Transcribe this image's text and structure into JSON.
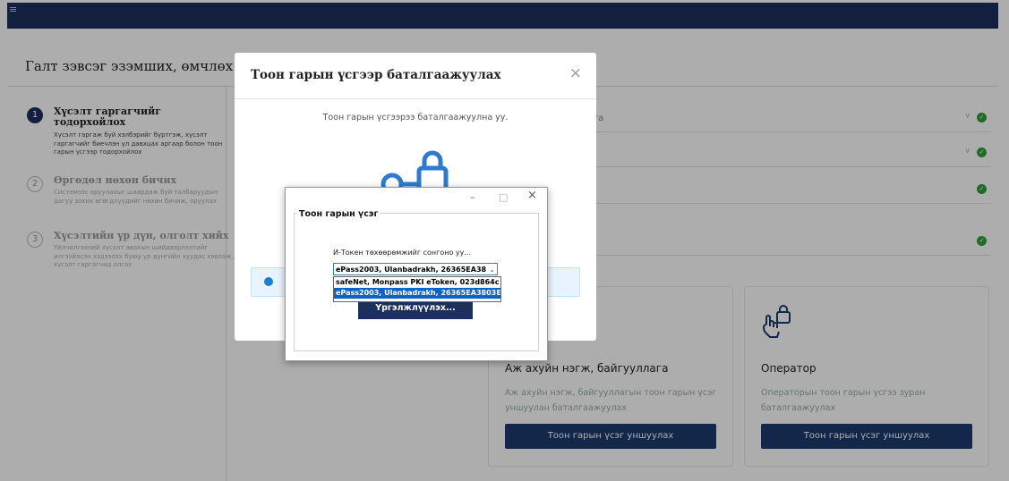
{
  "page": {
    "title": "Галт зэвсэг эзэмших, өмчлөх эрх"
  },
  "steps": [
    {
      "number": "1",
      "title": "Хүсэлт гаргагчийг тодорхойлох",
      "description": "Хүсэлт гаргаж буй хэлбэрийг бүртгэж, хүсэлт гаргагчийг биечлэн үл давхцах аргаар болон тоон гарын үсгээр тодорхойлох"
    },
    {
      "number": "2",
      "title": "Өргөдөл нөхөн бичих",
      "description": "Системээс оруулахыг шаардаж буй талбаруудын дагуу зохих өгөгдлүүдийг нөхөн бичиж, оруулах"
    },
    {
      "number": "3",
      "title": "Хүсэлтийн үр дүн, олголт хийх",
      "description": "Үйлчилгээний хүсэлт авахын шийдвэрлэлтийг илгээйлсэн хэдээлэх буюу үр дүнгийн хуудас хэвлэж, хүсэлт гаргагчид олгох"
    }
  ],
  "right_rows": [
    {
      "text": "ллага",
      "has_chevron": true
    },
    {
      "text": "",
      "has_chevron": true
    },
    {
      "text": "",
      "has_chevron": false
    },
    {
      "text": "",
      "has_chevron": false
    }
  ],
  "cards": [
    {
      "title": "Аж ахуйн нэгж, байгууллага",
      "description": "Аж ахуйн нэгж, байгууллагын тоон гарын үсэг уншуулан баталгаажуулах",
      "button": "Тоон гарын үсэг уншуулах"
    },
    {
      "title": "Оператор",
      "description": "Операторын тоон гарын үсгээ зуран баталгаажуулах",
      "button": "Тоон гарын үсэг уншуулах"
    }
  ],
  "modal": {
    "title": "Тоон гарын үсгээр баталгаажуулах",
    "close": "×",
    "text": "Тоон гарын үсгээрээ баталгаажуулна уу."
  },
  "native_window": {
    "minimize": "–",
    "maximize": "□",
    "close": "×",
    "group_label": "Тоон гарын үсэг",
    "prompt": "И-Токен төхөөрөмжийг сонгоно уу...",
    "selected": "ePass2003, Ulanbadrakh, 26365EA38",
    "options": [
      "safeNet, Monpass PKI eToken, 023d864c",
      "ePass2003, Ulanbadrakh, 26365EA3803E"
    ],
    "proceed": "Үргэлжлүүлэх..."
  },
  "colors": {
    "brand": "#1c2f5e",
    "success": "#2e9e3a",
    "info": "#1a7fd0"
  }
}
